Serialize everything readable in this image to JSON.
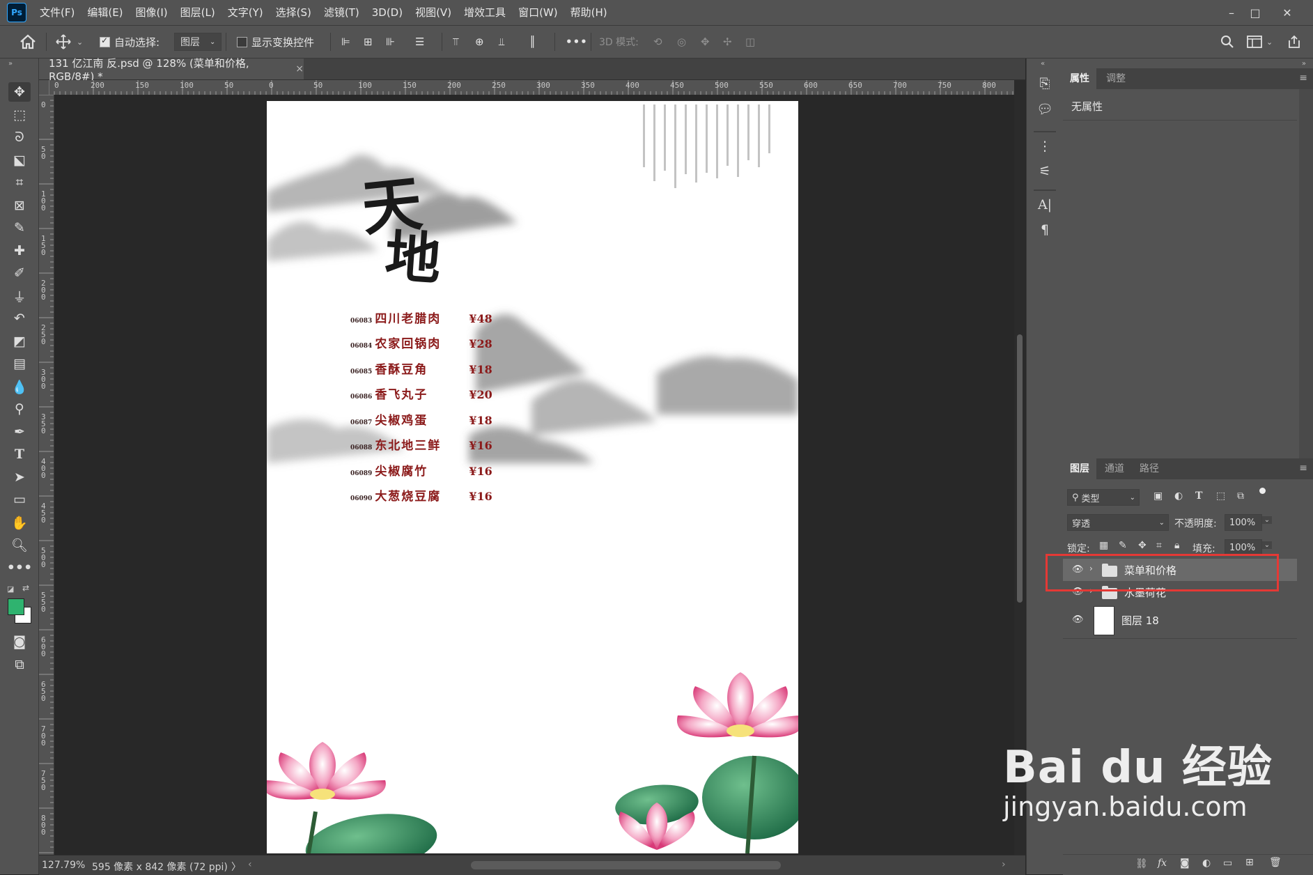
{
  "app": {
    "logo": "Ps"
  },
  "menubar": {
    "items": [
      "文件(F)",
      "编辑(E)",
      "图像(I)",
      "图层(L)",
      "文字(Y)",
      "选择(S)",
      "滤镜(T)",
      "3D(D)",
      "视图(V)",
      "增效工具",
      "窗口(W)",
      "帮助(H)"
    ],
    "window_controls": [
      "–",
      "□",
      "✕"
    ]
  },
  "options": {
    "auto_select_label": "自动选择:",
    "auto_select_value": "图层",
    "show_transform_label": "显示变换控件",
    "mode_3d_label": "3D 模式:",
    "more_label": "•••"
  },
  "document": {
    "tab_title": "131 亿江南 反.psd @ 128% (菜单和价格, RGB/8#) *",
    "close": "×",
    "title_art": "天地",
    "menu": [
      {
        "code": "06083",
        "dish": "四川老腊肉",
        "price": "¥48"
      },
      {
        "code": "06084",
        "dish": "农家回锅肉",
        "price": "¥28"
      },
      {
        "code": "06085",
        "dish": "香酥豆角",
        "price": "¥18"
      },
      {
        "code": "06086",
        "dish": "香飞丸子",
        "price": "¥20"
      },
      {
        "code": "06087",
        "dish": "尖椒鸡蛋",
        "price": "¥18"
      },
      {
        "code": "06088",
        "dish": "东北地三鲜",
        "price": "¥16"
      },
      {
        "code": "06089",
        "dish": "尖椒腐竹",
        "price": "¥16"
      },
      {
        "code": "06090",
        "dish": "大葱烧豆腐",
        "price": "¥16"
      }
    ]
  },
  "rulers": {
    "h_ticks": [
      "0",
      "200",
      "150",
      "100",
      "50",
      "0",
      "50",
      "100",
      "150",
      "200",
      "250",
      "300",
      "350",
      "400",
      "450",
      "500",
      "550",
      "600",
      "650",
      "700",
      "750",
      "800"
    ],
    "v_ticks": [
      "0",
      "5 0",
      "1 0 0",
      "1 5 0",
      "2 0 0",
      "2 5 0",
      "3 0 0",
      "3 5 0",
      "4 0 0",
      "4 5 0",
      "5 0 0",
      "5 5 0",
      "6 0 0",
      "6 5 0",
      "7 0 0",
      "7 5 0",
      "8 0 0"
    ]
  },
  "status": {
    "zoom": "127.79%",
    "doc_info": "595 像素 x 842 像素 (72 ppi)",
    "arrow": "〉"
  },
  "properties_panel": {
    "tabs": [
      "属性",
      "调整"
    ],
    "content": "无属性"
  },
  "layers_panel": {
    "tabs": [
      "图层",
      "通道",
      "路径"
    ],
    "filter_kind": "类型",
    "blend_mode": "穿透",
    "opacity_label": "不透明度:",
    "opacity_value": "100%",
    "lock_label": "锁定:",
    "fill_label": "填充:",
    "fill_value": "100%",
    "layers": [
      {
        "name": "菜单和价格",
        "type": "group",
        "selected": true
      },
      {
        "name": "水墨荷花",
        "type": "group",
        "selected": false
      },
      {
        "name": "图层 18",
        "type": "layer",
        "selected": false
      }
    ],
    "footer_icons": [
      "link-icon",
      "fx-icon",
      "mask-icon",
      "adjustment-icon",
      "folder-icon",
      "new-layer-icon",
      "trash-icon"
    ]
  },
  "watermark": {
    "brand": "Bai du 经验",
    "url": "jingyan.baidu.com"
  },
  "colors": {
    "foreground": "#2fb36f",
    "background": "#ffffff",
    "highlight": "#e53935",
    "menu_text": "#8b1a1a"
  }
}
